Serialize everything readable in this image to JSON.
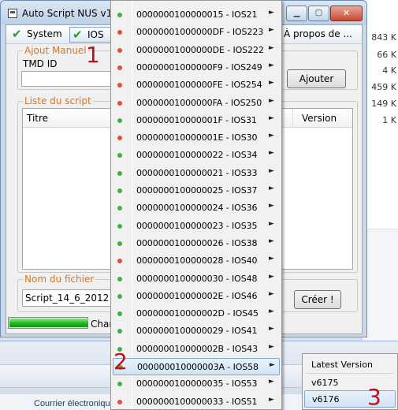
{
  "window": {
    "title": "Auto Script NUS v1.0",
    "caption_min": "▁",
    "caption_max": "▢",
    "caption_close": "✕"
  },
  "menubar": {
    "system": "System",
    "ios": "IOS",
    "apropos": "À propos de ..."
  },
  "ajout": {
    "group_label": "Ajout Manuel",
    "tmd_label": "TMD ID",
    "tmd_value": "",
    "add_button": "Ajouter"
  },
  "liste": {
    "group_label": "Liste du script",
    "columns": [
      "Titre",
      "Version"
    ]
  },
  "fichier": {
    "group_label": "Nom du fichier",
    "value": "Script_14_6_2012",
    "create_button": "Créer !"
  },
  "status": {
    "progress_fraction": 1.0,
    "text": "Char"
  },
  "dropdown": {
    "items": [
      {
        "label": "0000000100000015 - IOS21",
        "bullet": "green"
      },
      {
        "label": "00000001000000DF - IOS223",
        "bullet": "red"
      },
      {
        "label": "00000001000000DE - IOS222",
        "bullet": "red"
      },
      {
        "label": "00000001000000F9 - IOS249",
        "bullet": "red"
      },
      {
        "label": "00000001000000FE - IOS254",
        "bullet": "red"
      },
      {
        "label": "00000001000000FA - IOS250",
        "bullet": "red"
      },
      {
        "label": "000000010000001F - IOS31",
        "bullet": "green"
      },
      {
        "label": "000000010000001E - IOS30",
        "bullet": "red"
      },
      {
        "label": "0000000100000022 - IOS34",
        "bullet": "green"
      },
      {
        "label": "0000000100000021 - IOS33",
        "bullet": "green"
      },
      {
        "label": "0000000100000025 - IOS37",
        "bullet": "green"
      },
      {
        "label": "0000000100000024 - IOS36",
        "bullet": "green"
      },
      {
        "label": "0000000100000023 - IOS35",
        "bullet": "green"
      },
      {
        "label": "0000000100000026 - IOS38",
        "bullet": "green"
      },
      {
        "label": "0000000100000028 - IOS40",
        "bullet": "red"
      },
      {
        "label": "0000000100000030 - IOS48",
        "bullet": "green"
      },
      {
        "label": "000000010000002E - IOS46",
        "bullet": "green"
      },
      {
        "label": "000000010000002D - IOS45",
        "bullet": "green"
      },
      {
        "label": "0000000100000029 - IOS41",
        "bullet": "green"
      },
      {
        "label": "000000010000002B - IOS43",
        "bullet": "green"
      },
      {
        "label": "000000010000003A - IOS58",
        "bullet": "green",
        "selected": true
      },
      {
        "label": "0000000100000035 - IOS53",
        "bullet": "green"
      },
      {
        "label": "0000000100000033 - IOS51",
        "bullet": "red"
      }
    ],
    "arrow": "►"
  },
  "submenu": {
    "items": [
      "Latest Version",
      "v6175",
      "v6176"
    ],
    "selected_index": 2
  },
  "annotations": [
    "1",
    "2",
    "3"
  ],
  "background": {
    "counts": [
      "843 K",
      "66 K",
      "4 K",
      "459 K",
      "149 K",
      "1 K"
    ],
    "taskbar_label": "Courrier électronique"
  }
}
